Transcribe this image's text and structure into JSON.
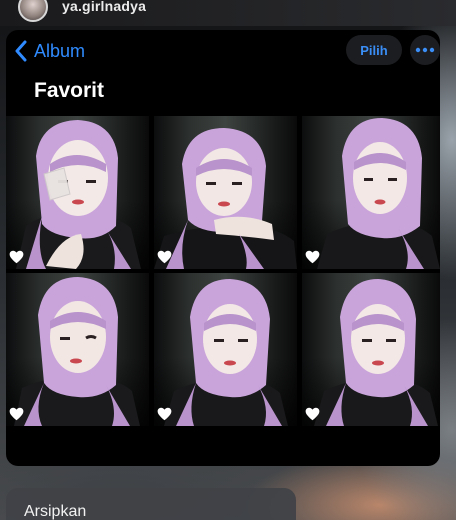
{
  "header": {
    "username": "ya.girlnadya"
  },
  "nav": {
    "back_label": "Album",
    "select_label": "Pilih"
  },
  "album": {
    "title": "Favorit",
    "photos": [
      {
        "favorite": true
      },
      {
        "favorite": true
      },
      {
        "favorite": true
      },
      {
        "favorite": true
      },
      {
        "favorite": true
      },
      {
        "favorite": true
      }
    ]
  },
  "menu": {
    "items": [
      {
        "label": "Arsipkan"
      }
    ]
  },
  "colors": {
    "accent": "#2f8bff",
    "hijab": "#c7a3d9",
    "background": "#000000"
  }
}
